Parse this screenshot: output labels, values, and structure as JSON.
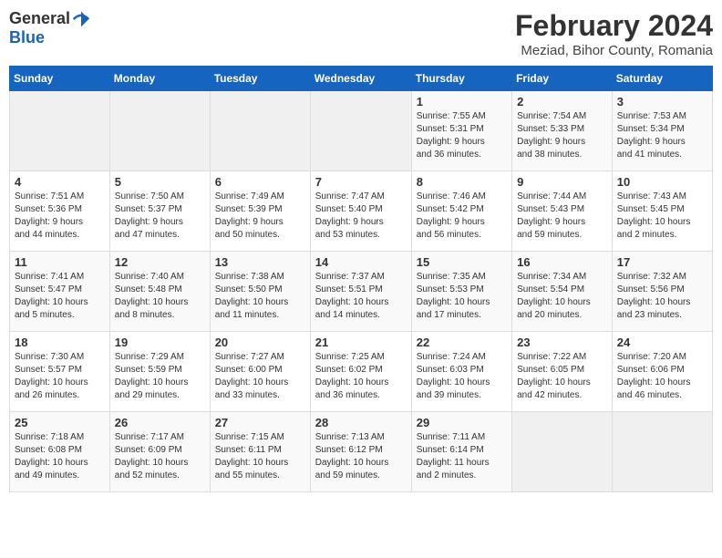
{
  "header": {
    "logo": {
      "general": "General",
      "blue": "Blue"
    },
    "title": "February 2024",
    "subtitle": "Meziad, Bihor County, Romania"
  },
  "calendar": {
    "days_of_week": [
      "Sunday",
      "Monday",
      "Tuesday",
      "Wednesday",
      "Thursday",
      "Friday",
      "Saturday"
    ],
    "weeks": [
      [
        {
          "day": "",
          "info": ""
        },
        {
          "day": "",
          "info": ""
        },
        {
          "day": "",
          "info": ""
        },
        {
          "day": "",
          "info": ""
        },
        {
          "day": "1",
          "info": "Sunrise: 7:55 AM\nSunset: 5:31 PM\nDaylight: 9 hours\nand 36 minutes."
        },
        {
          "day": "2",
          "info": "Sunrise: 7:54 AM\nSunset: 5:33 PM\nDaylight: 9 hours\nand 38 minutes."
        },
        {
          "day": "3",
          "info": "Sunrise: 7:53 AM\nSunset: 5:34 PM\nDaylight: 9 hours\nand 41 minutes."
        }
      ],
      [
        {
          "day": "4",
          "info": "Sunrise: 7:51 AM\nSunset: 5:36 PM\nDaylight: 9 hours\nand 44 minutes."
        },
        {
          "day": "5",
          "info": "Sunrise: 7:50 AM\nSunset: 5:37 PM\nDaylight: 9 hours\nand 47 minutes."
        },
        {
          "day": "6",
          "info": "Sunrise: 7:49 AM\nSunset: 5:39 PM\nDaylight: 9 hours\nand 50 minutes."
        },
        {
          "day": "7",
          "info": "Sunrise: 7:47 AM\nSunset: 5:40 PM\nDaylight: 9 hours\nand 53 minutes."
        },
        {
          "day": "8",
          "info": "Sunrise: 7:46 AM\nSunset: 5:42 PM\nDaylight: 9 hours\nand 56 minutes."
        },
        {
          "day": "9",
          "info": "Sunrise: 7:44 AM\nSunset: 5:43 PM\nDaylight: 9 hours\nand 59 minutes."
        },
        {
          "day": "10",
          "info": "Sunrise: 7:43 AM\nSunset: 5:45 PM\nDaylight: 10 hours\nand 2 minutes."
        }
      ],
      [
        {
          "day": "11",
          "info": "Sunrise: 7:41 AM\nSunset: 5:47 PM\nDaylight: 10 hours\nand 5 minutes."
        },
        {
          "day": "12",
          "info": "Sunrise: 7:40 AM\nSunset: 5:48 PM\nDaylight: 10 hours\nand 8 minutes."
        },
        {
          "day": "13",
          "info": "Sunrise: 7:38 AM\nSunset: 5:50 PM\nDaylight: 10 hours\nand 11 minutes."
        },
        {
          "day": "14",
          "info": "Sunrise: 7:37 AM\nSunset: 5:51 PM\nDaylight: 10 hours\nand 14 minutes."
        },
        {
          "day": "15",
          "info": "Sunrise: 7:35 AM\nSunset: 5:53 PM\nDaylight: 10 hours\nand 17 minutes."
        },
        {
          "day": "16",
          "info": "Sunrise: 7:34 AM\nSunset: 5:54 PM\nDaylight: 10 hours\nand 20 minutes."
        },
        {
          "day": "17",
          "info": "Sunrise: 7:32 AM\nSunset: 5:56 PM\nDaylight: 10 hours\nand 23 minutes."
        }
      ],
      [
        {
          "day": "18",
          "info": "Sunrise: 7:30 AM\nSunset: 5:57 PM\nDaylight: 10 hours\nand 26 minutes."
        },
        {
          "day": "19",
          "info": "Sunrise: 7:29 AM\nSunset: 5:59 PM\nDaylight: 10 hours\nand 29 minutes."
        },
        {
          "day": "20",
          "info": "Sunrise: 7:27 AM\nSunset: 6:00 PM\nDaylight: 10 hours\nand 33 minutes."
        },
        {
          "day": "21",
          "info": "Sunrise: 7:25 AM\nSunset: 6:02 PM\nDaylight: 10 hours\nand 36 minutes."
        },
        {
          "day": "22",
          "info": "Sunrise: 7:24 AM\nSunset: 6:03 PM\nDaylight: 10 hours\nand 39 minutes."
        },
        {
          "day": "23",
          "info": "Sunrise: 7:22 AM\nSunset: 6:05 PM\nDaylight: 10 hours\nand 42 minutes."
        },
        {
          "day": "24",
          "info": "Sunrise: 7:20 AM\nSunset: 6:06 PM\nDaylight: 10 hours\nand 46 minutes."
        }
      ],
      [
        {
          "day": "25",
          "info": "Sunrise: 7:18 AM\nSunset: 6:08 PM\nDaylight: 10 hours\nand 49 minutes."
        },
        {
          "day": "26",
          "info": "Sunrise: 7:17 AM\nSunset: 6:09 PM\nDaylight: 10 hours\nand 52 minutes."
        },
        {
          "day": "27",
          "info": "Sunrise: 7:15 AM\nSunset: 6:11 PM\nDaylight: 10 hours\nand 55 minutes."
        },
        {
          "day": "28",
          "info": "Sunrise: 7:13 AM\nSunset: 6:12 PM\nDaylight: 10 hours\nand 59 minutes."
        },
        {
          "day": "29",
          "info": "Sunrise: 7:11 AM\nSunset: 6:14 PM\nDaylight: 11 hours\nand 2 minutes."
        },
        {
          "day": "",
          "info": ""
        },
        {
          "day": "",
          "info": ""
        }
      ]
    ]
  }
}
